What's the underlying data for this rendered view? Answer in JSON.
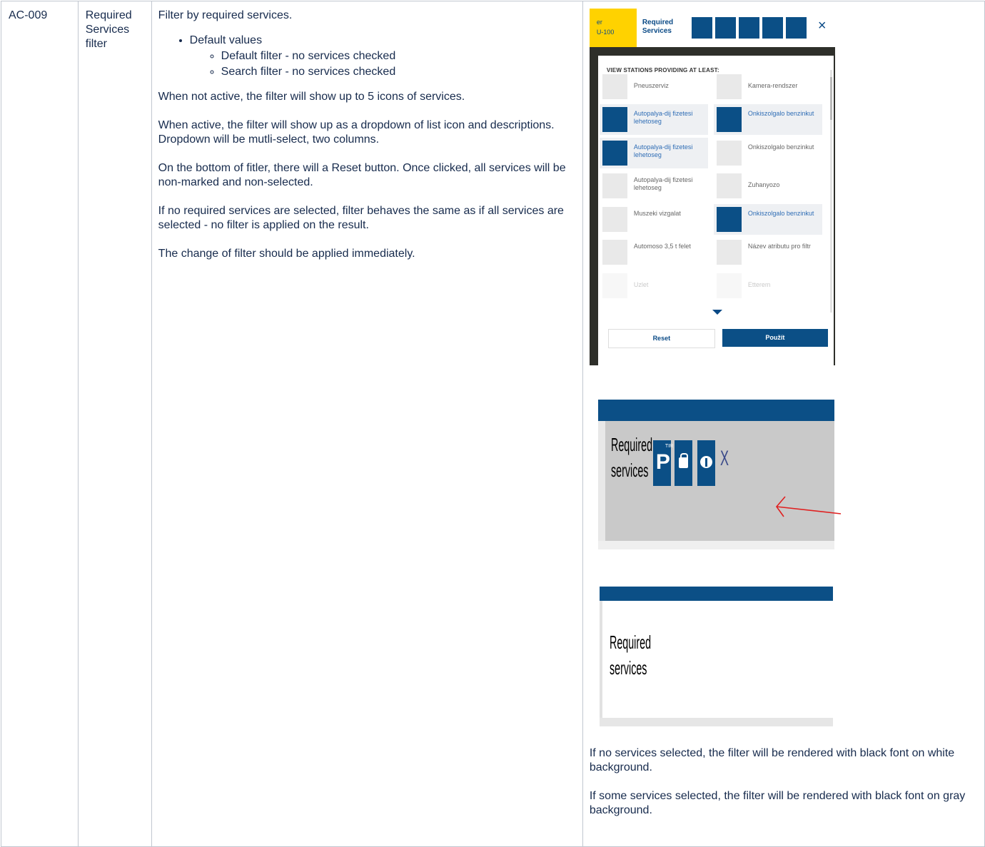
{
  "row": {
    "id": "AC-009",
    "name": "Required Services filter",
    "description": {
      "intro": "Filter by required services.",
      "defaults_heading": "Default values",
      "defaults": [
        "Default filter - no services checked",
        "Search filter - no services checked"
      ],
      "paragraphs": [
        "When not active, the filter will show up to 5 icons of services.",
        "When active, the filter will show up as a dropdown of list icon and descriptions. Dropdown will be mutli-select, two columns.",
        "On the bottom of fitler, there will a Reset button. Once clicked, all services will be non-marked and non-selected.",
        "If no required services are selected, filter behaves the same as if all services are selected - no filter is applied on the result.",
        "The change of filter should be applied immediately."
      ]
    },
    "mockup": {
      "top_left_line1": "er",
      "top_left_line2": "U-100",
      "filter_label": "Required Services",
      "close_glyph": "×",
      "panel_title": "VIEW STATIONS PROVIDING AT LEAST:",
      "services": [
        {
          "label": "Pneuszerviz",
          "selected": false
        },
        {
          "label": "Kamera-rendszer",
          "selected": false
        },
        {
          "label": "Autopalya-dij fizetesi lehetoseg",
          "selected": true
        },
        {
          "label": "Onkiszolgalo benzinkut",
          "selected": true
        },
        {
          "label": "Autopalya-dij fizetesi lehetoseg",
          "selected": true
        },
        {
          "label": "Onkiszolgalo benzinkut",
          "selected": false
        },
        {
          "label": "Autopalya-dij fizetesi lehetoseg",
          "selected": false
        },
        {
          "label": "Zuhanyozo",
          "selected": false
        },
        {
          "label": "Muszeki vizgalat",
          "selected": false
        },
        {
          "label": "Onkiszolgalo benzinkut",
          "selected": true
        },
        {
          "label": "Automoso 3,5 t felet",
          "selected": false
        },
        {
          "label": "Název atributu pro filtr",
          "selected": false
        },
        {
          "label": "Uzlet",
          "selected": false
        },
        {
          "label": "Etterem",
          "selected": false
        }
      ],
      "reset_label": "Reset",
      "apply_label": "Použít"
    },
    "compact_active": {
      "label_line1": "Required",
      "label_line2": "services",
      "parking_letter": "P",
      "parking_sup": "TIR",
      "clear_glyph": "X"
    },
    "compact_inactive": {
      "label_line1": "Required",
      "label_line2": "services"
    },
    "notes": [
      "If no services selected, the filter will be rendered with black font on white background.",
      "If some services selected, the filter will be rendered with black font on gray background."
    ]
  },
  "colors": {
    "brand_blue": "#0b4f86",
    "brand_yellow": "#ffd200",
    "selected_label": "#2f6db5",
    "gray_bg": "#c9c9c9",
    "arrow_red": "#e02020"
  }
}
